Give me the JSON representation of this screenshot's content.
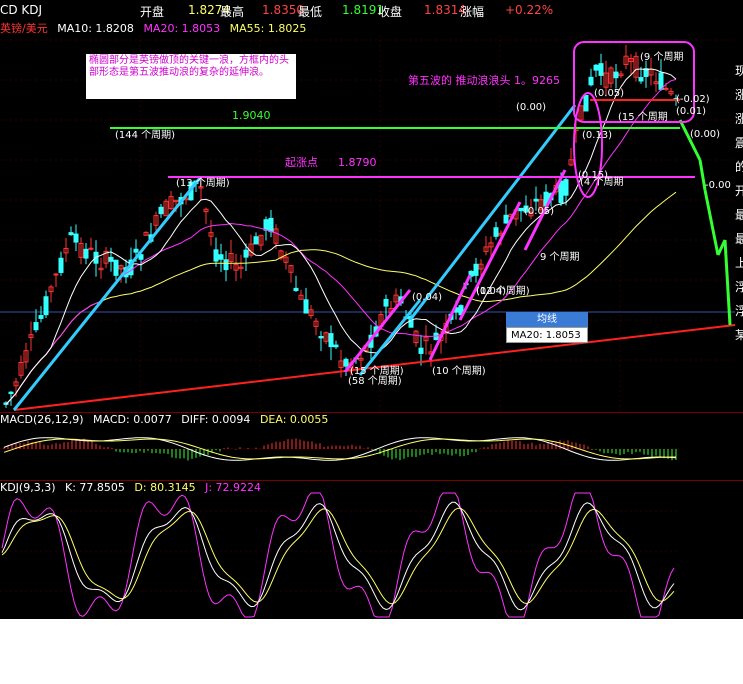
{
  "topbar": {
    "symbol": "CD KDJ",
    "open_label": "开盘",
    "open_value": "1.8274",
    "high_label": "最高",
    "high_value": "1.8350",
    "low_label": "最低",
    "low_value": "1.8191",
    "close_label": "收盘",
    "close_value": "1.8314",
    "change_label": "涨幅",
    "change_value": "+0.22%"
  },
  "price_header": {
    "symbol": "英镑/美元",
    "ma10": "MA10: 1.8208",
    "ma20": "MA20: 1.8053",
    "ma55": "MA55: 1.8025"
  },
  "macd_header": {
    "params": "MACD(26,12,9)",
    "macd": "MACD: 0.0077",
    "diff": "DIFF: 0.0094",
    "dea": "DEA: 0.0055"
  },
  "kdj_header": {
    "params": "KDJ(9,3,3)",
    "k": "K: 77.8505",
    "d": "D: 80.3145",
    "j": "J: 72.9224"
  },
  "annotations": {
    "note": "椭圆部分是英镑做顶的关键一浪，方框内的头部形态是第五波推动浪的复杂的延伸浪。",
    "fifth_wave": "第五波的 推动浪浪头 1。9265",
    "level_high": "1.9040",
    "level_mid_label": "起涨点",
    "level_mid": "1.8790",
    "p144": "(144 个周期)",
    "p13": "(13 个周期)",
    "p15": "(15 个周期)",
    "p58": "(58 个周期)",
    "p10": "(10 个周期)",
    "p9a": "(9 个周期",
    "p9b": "9 个周期",
    "p12": "(12 个周期)",
    "p15b": "(15 个周期",
    "p4": "(4 个周期",
    "v_002": "(-0.02)",
    "v_000": "(0.00)",
    "v_001": "(0.01)",
    "v_000b": "(0.00)",
    "v_005": "(0.05)",
    "v_013": "(0.13)",
    "v_015": "(0.15)",
    "v_005b": "(0.05)",
    "v_004": "(0.04)",
    "v_004b": "(0.04)",
    "v_neg000": "-0.00"
  },
  "tooltip": {
    "header": "均线",
    "value": "MA20: 1.8053"
  },
  "right_labels": [
    "现",
    "涨",
    "涨",
    "震",
    "的",
    "开",
    "最",
    "最",
    "上",
    "浮",
    "浮",
    "某"
  ],
  "colors": {
    "up": "#ff3333",
    "down": "#33ffff",
    "ma10": "#ffffff",
    "ma20": "#ff33ff",
    "ma55": "#ffff66",
    "trend_red": "#ff2020",
    "trend_cyan": "#33ccff",
    "trend_magenta": "#ff33ff",
    "level_green": "#33ff33",
    "level_magenta": "#ff33ff"
  },
  "chart_data": [
    {
      "type": "candlestick",
      "title": "英镑/美元",
      "series": [
        {
          "name": "MA10",
          "values": [
            1.8208
          ]
        },
        {
          "name": "MA20",
          "values": [
            1.8053
          ]
        },
        {
          "name": "MA55",
          "values": [
            1.8025
          ]
        }
      ],
      "levels": [
        1.904,
        1.879,
        1.9265
      ],
      "last": {
        "open": 1.8274,
        "high": 1.835,
        "low": 1.8191,
        "close": 1.8314
      }
    },
    {
      "type": "bar",
      "title": "MACD(26,12,9)",
      "series": [
        {
          "name": "MACD",
          "values": [
            0.0077
          ]
        },
        {
          "name": "DIFF",
          "values": [
            0.0094
          ]
        },
        {
          "name": "DEA",
          "values": [
            0.0055
          ]
        }
      ]
    },
    {
      "type": "line",
      "title": "KDJ(9,3,3)",
      "series": [
        {
          "name": "K",
          "values": [
            77.8505
          ]
        },
        {
          "name": "D",
          "values": [
            80.3145
          ]
        },
        {
          "name": "J",
          "values": [
            72.9224
          ]
        }
      ]
    }
  ]
}
